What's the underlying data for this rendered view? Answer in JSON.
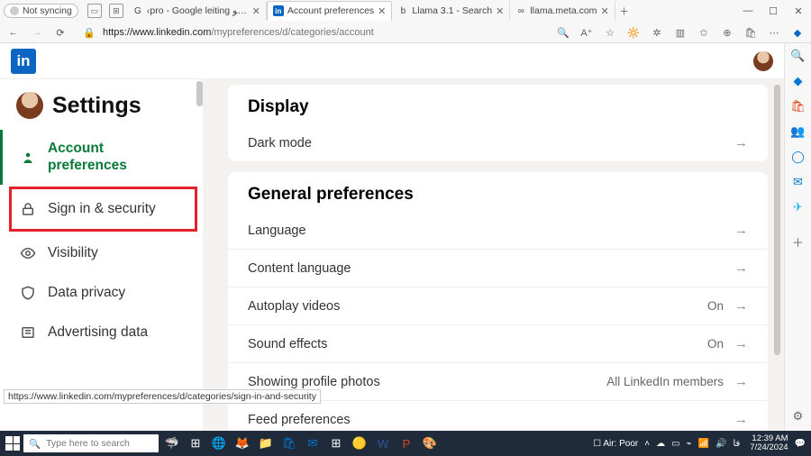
{
  "browser": {
    "sync_label": "Not syncing",
    "tabs": [
      {
        "title": "‹pro - Google leiting کرائین کادیو",
        "fav": "G"
      },
      {
        "title": "Account preferences",
        "fav": "in"
      },
      {
        "title": "Llama 3.1 - Search",
        "fav": "b"
      },
      {
        "title": "llama.meta.com",
        "fav": "∞"
      }
    ],
    "url_host": "https://www.linkedin.com",
    "url_path": "/mypreferences/d/categories/account",
    "status_link": "https://www.linkedin.com/mypreferences/d/categories/sign-in-and-security"
  },
  "page": {
    "settings_title": "Settings",
    "nav": {
      "account": "Account preferences",
      "security": "Sign in & security",
      "visibility": "Visibility",
      "privacy": "Data privacy",
      "ads": "Advertising data"
    },
    "sections": {
      "display": {
        "title": "Display",
        "rows": {
          "dark_mode": "Dark mode"
        }
      },
      "general": {
        "title": "General preferences",
        "rows": {
          "language": "Language",
          "content_language": "Content language",
          "autoplay": "Autoplay videos",
          "autoplay_val": "On",
          "sound": "Sound effects",
          "sound_val": "On",
          "photos": "Showing profile photos",
          "photos_val": "All LinkedIn members",
          "feed": "Feed preferences"
        }
      }
    }
  },
  "taskbar": {
    "search_placeholder": "Type here to search",
    "weather": "Air: Poor",
    "time": "12:39 AM",
    "date": "7/24/2024",
    "lang": "فا"
  }
}
